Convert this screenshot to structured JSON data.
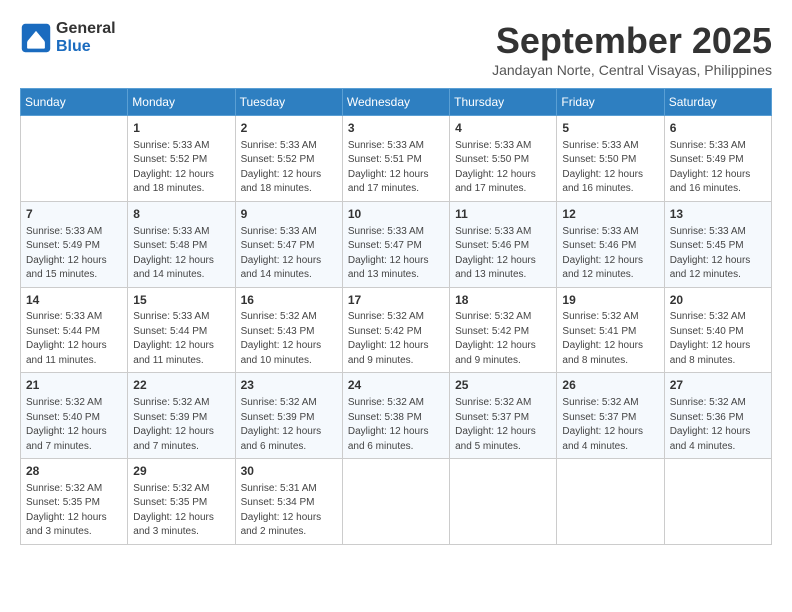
{
  "logo": {
    "line1": "General",
    "line2": "Blue"
  },
  "title": "September 2025",
  "subtitle": "Jandayan Norte, Central Visayas, Philippines",
  "header": {
    "days": [
      "Sunday",
      "Monday",
      "Tuesday",
      "Wednesday",
      "Thursday",
      "Friday",
      "Saturday"
    ]
  },
  "weeks": [
    [
      {
        "day": "",
        "info": ""
      },
      {
        "day": "1",
        "info": "Sunrise: 5:33 AM\nSunset: 5:52 PM\nDaylight: 12 hours\nand 18 minutes."
      },
      {
        "day": "2",
        "info": "Sunrise: 5:33 AM\nSunset: 5:52 PM\nDaylight: 12 hours\nand 18 minutes."
      },
      {
        "day": "3",
        "info": "Sunrise: 5:33 AM\nSunset: 5:51 PM\nDaylight: 12 hours\nand 17 minutes."
      },
      {
        "day": "4",
        "info": "Sunrise: 5:33 AM\nSunset: 5:50 PM\nDaylight: 12 hours\nand 17 minutes."
      },
      {
        "day": "5",
        "info": "Sunrise: 5:33 AM\nSunset: 5:50 PM\nDaylight: 12 hours\nand 16 minutes."
      },
      {
        "day": "6",
        "info": "Sunrise: 5:33 AM\nSunset: 5:49 PM\nDaylight: 12 hours\nand 16 minutes."
      }
    ],
    [
      {
        "day": "7",
        "info": "Sunrise: 5:33 AM\nSunset: 5:49 PM\nDaylight: 12 hours\nand 15 minutes."
      },
      {
        "day": "8",
        "info": "Sunrise: 5:33 AM\nSunset: 5:48 PM\nDaylight: 12 hours\nand 14 minutes."
      },
      {
        "day": "9",
        "info": "Sunrise: 5:33 AM\nSunset: 5:47 PM\nDaylight: 12 hours\nand 14 minutes."
      },
      {
        "day": "10",
        "info": "Sunrise: 5:33 AM\nSunset: 5:47 PM\nDaylight: 12 hours\nand 13 minutes."
      },
      {
        "day": "11",
        "info": "Sunrise: 5:33 AM\nSunset: 5:46 PM\nDaylight: 12 hours\nand 13 minutes."
      },
      {
        "day": "12",
        "info": "Sunrise: 5:33 AM\nSunset: 5:46 PM\nDaylight: 12 hours\nand 12 minutes."
      },
      {
        "day": "13",
        "info": "Sunrise: 5:33 AM\nSunset: 5:45 PM\nDaylight: 12 hours\nand 12 minutes."
      }
    ],
    [
      {
        "day": "14",
        "info": "Sunrise: 5:33 AM\nSunset: 5:44 PM\nDaylight: 12 hours\nand 11 minutes."
      },
      {
        "day": "15",
        "info": "Sunrise: 5:33 AM\nSunset: 5:44 PM\nDaylight: 12 hours\nand 11 minutes."
      },
      {
        "day": "16",
        "info": "Sunrise: 5:32 AM\nSunset: 5:43 PM\nDaylight: 12 hours\nand 10 minutes."
      },
      {
        "day": "17",
        "info": "Sunrise: 5:32 AM\nSunset: 5:42 PM\nDaylight: 12 hours\nand 9 minutes."
      },
      {
        "day": "18",
        "info": "Sunrise: 5:32 AM\nSunset: 5:42 PM\nDaylight: 12 hours\nand 9 minutes."
      },
      {
        "day": "19",
        "info": "Sunrise: 5:32 AM\nSunset: 5:41 PM\nDaylight: 12 hours\nand 8 minutes."
      },
      {
        "day": "20",
        "info": "Sunrise: 5:32 AM\nSunset: 5:40 PM\nDaylight: 12 hours\nand 8 minutes."
      }
    ],
    [
      {
        "day": "21",
        "info": "Sunrise: 5:32 AM\nSunset: 5:40 PM\nDaylight: 12 hours\nand 7 minutes."
      },
      {
        "day": "22",
        "info": "Sunrise: 5:32 AM\nSunset: 5:39 PM\nDaylight: 12 hours\nand 7 minutes."
      },
      {
        "day": "23",
        "info": "Sunrise: 5:32 AM\nSunset: 5:39 PM\nDaylight: 12 hours\nand 6 minutes."
      },
      {
        "day": "24",
        "info": "Sunrise: 5:32 AM\nSunset: 5:38 PM\nDaylight: 12 hours\nand 6 minutes."
      },
      {
        "day": "25",
        "info": "Sunrise: 5:32 AM\nSunset: 5:37 PM\nDaylight: 12 hours\nand 5 minutes."
      },
      {
        "day": "26",
        "info": "Sunrise: 5:32 AM\nSunset: 5:37 PM\nDaylight: 12 hours\nand 4 minutes."
      },
      {
        "day": "27",
        "info": "Sunrise: 5:32 AM\nSunset: 5:36 PM\nDaylight: 12 hours\nand 4 minutes."
      }
    ],
    [
      {
        "day": "28",
        "info": "Sunrise: 5:32 AM\nSunset: 5:35 PM\nDaylight: 12 hours\nand 3 minutes."
      },
      {
        "day": "29",
        "info": "Sunrise: 5:32 AM\nSunset: 5:35 PM\nDaylight: 12 hours\nand 3 minutes."
      },
      {
        "day": "30",
        "info": "Sunrise: 5:31 AM\nSunset: 5:34 PM\nDaylight: 12 hours\nand 2 minutes."
      },
      {
        "day": "",
        "info": ""
      },
      {
        "day": "",
        "info": ""
      },
      {
        "day": "",
        "info": ""
      },
      {
        "day": "",
        "info": ""
      }
    ]
  ]
}
